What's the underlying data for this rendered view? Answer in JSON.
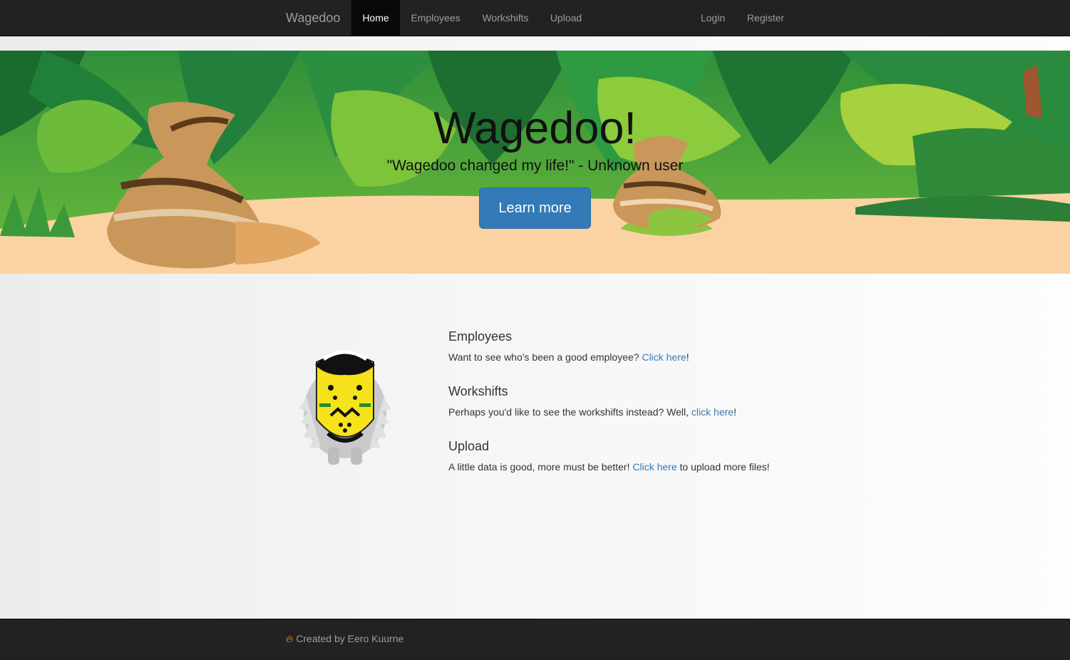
{
  "navbar": {
    "brand": "Wagedoo",
    "items": [
      {
        "label": "Home",
        "active": true
      },
      {
        "label": "Employees"
      },
      {
        "label": "Workshifts"
      },
      {
        "label": "Upload"
      }
    ],
    "right_items": [
      {
        "label": "Login"
      },
      {
        "label": "Register"
      }
    ]
  },
  "hero": {
    "title": "Wagedoo!",
    "quote": "\"Wagedoo changed my life!\" - Unknown user",
    "button_label": "Learn more"
  },
  "features": [
    {
      "heading": "Employees",
      "text_before": "Want to see who's been a good employee? ",
      "link": "Click here",
      "text_after": "!"
    },
    {
      "heading": "Workshifts",
      "text_before": "Perhaps you'd like to see the workshifts instead? Well, ",
      "link": "click here",
      "text_after": "!"
    },
    {
      "heading": "Upload",
      "text_before": "A little data is good, more must be better! ",
      "link": "Click here",
      "text_after": " to upload more files!"
    }
  ],
  "footer": {
    "icon": "fire-icon",
    "credit": "Created by Eero Kuurne"
  },
  "colors": {
    "navbar_bg": "#222222",
    "link": "#337ab7",
    "button": "#337ab7",
    "sand": "#fbd3a3"
  }
}
